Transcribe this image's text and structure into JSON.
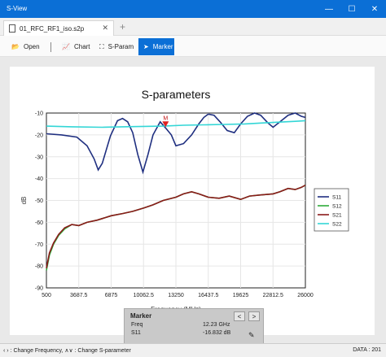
{
  "window": {
    "title": "S-View",
    "minimize": "—",
    "maximize": "☐",
    "close": "✕"
  },
  "tabs": [
    {
      "label": "01_RFC_RF1_iso.s2p",
      "close": "✕"
    }
  ],
  "new_tab": "+",
  "toolbar": {
    "open": {
      "icon": "📂",
      "label": "Open"
    },
    "chart": {
      "icon": "📈",
      "label": "Chart"
    },
    "sparam": {
      "icon": "⛶",
      "label": "S-Param"
    },
    "marker": {
      "icon": "➤",
      "label": "Marker"
    }
  },
  "marker_panel": {
    "title": "Marker",
    "prev": "<",
    "next": ">",
    "freq_label": "Freq",
    "freq_value": "12.23 GHz",
    "param_label": "S11",
    "param_value": "-16.832 dB",
    "edit_icon": "✎"
  },
  "status": {
    "hint": "‹ › : Change Frequency,  ∧∨ : Change S-parameter",
    "data": "DATA : 201"
  },
  "colors": {
    "accent": "#0b6fd6",
    "s11": "#1f2f80",
    "s12": "#2eab3a",
    "s21": "#8b1a1a",
    "s22": "#33d6d6"
  },
  "chart_data": {
    "type": "line",
    "title": "S-parameters",
    "xlabel": "Frequency (MHz)",
    "ylabel": "dB",
    "xlim": [
      500,
      26000
    ],
    "ylim": [
      -90,
      -10
    ],
    "xticks": [
      "500",
      "3687.5",
      "6875",
      "10062.5",
      "13250",
      "16437.5",
      "19625",
      "22812.5",
      "26000"
    ],
    "yticks": [
      "-10",
      "-20",
      "-30",
      "-40",
      "-50",
      "-60",
      "-70",
      "-80",
      "-90"
    ],
    "legend_position": "right",
    "marker": {
      "label": "M",
      "x": 12230,
      "y": -16.8
    },
    "series": [
      {
        "name": "S11",
        "color": "#1f2f80",
        "x": [
          500,
          2000,
          3500,
          4500,
          5200,
          5600,
          6000,
          6800,
          7500,
          8000,
          8500,
          9000,
          9500,
          10000,
          10500,
          11000,
          11700,
          12230,
          12800,
          13250,
          14000,
          14800,
          15500,
          16000,
          16437,
          17000,
          17600,
          18300,
          19000,
          19625,
          20300,
          21000,
          21600,
          22300,
          22813,
          23500,
          24300,
          25000,
          25600,
          26000
        ],
        "y": [
          -19.5,
          -20,
          -21,
          -25,
          -31,
          -36,
          -33,
          -20.5,
          -13.5,
          -12.5,
          -14,
          -19,
          -29,
          -37,
          -29,
          -20,
          -14,
          -16.8,
          -20,
          -25,
          -24,
          -20,
          -15,
          -12,
          -10.5,
          -11,
          -14,
          -18,
          -19,
          -15,
          -11.5,
          -10,
          -11,
          -14.5,
          -16.5,
          -14,
          -11,
          -10,
          -11.5,
          -12
        ]
      },
      {
        "name": "S12",
        "color": "#2eab3a",
        "x": [
          500,
          800,
          1200,
          1700,
          2300,
          3000,
          3687,
          4500,
          5500,
          6875,
          8000,
          9000,
          10062,
          11000,
          12000,
          13250,
          14000,
          14800,
          15500,
          16437,
          17500,
          18500,
          19625,
          20500,
          21500,
          22813,
          23500,
          24300,
          25000,
          25600,
          26000
        ],
        "y": [
          -82,
          -75,
          -70,
          -66,
          -63,
          -61,
          -61.5,
          -60,
          -59,
          -57,
          -56,
          -55,
          -53.5,
          -52,
          -50,
          -48.5,
          -47,
          -46,
          -47,
          -48.5,
          -49,
          -48,
          -49.5,
          -48,
          -47.5,
          -47,
          -46,
          -44.5,
          -45,
          -44,
          -43
        ]
      },
      {
        "name": "S21",
        "color": "#8b1a1a",
        "x": [
          500,
          800,
          1200,
          1700,
          2300,
          3000,
          3687,
          4500,
          5500,
          6875,
          8000,
          9000,
          10062,
          11000,
          12000,
          13250,
          14000,
          14800,
          15500,
          16437,
          17500,
          18500,
          19625,
          20500,
          21500,
          22813,
          23500,
          24300,
          25000,
          25600,
          26000
        ],
        "y": [
          -81,
          -74,
          -69.5,
          -65.5,
          -62.5,
          -61,
          -61.5,
          -60,
          -59,
          -57,
          -56,
          -55,
          -53.5,
          -52,
          -50,
          -48.5,
          -47,
          -46,
          -47,
          -48.5,
          -49,
          -48,
          -49.5,
          -48,
          -47.5,
          -47,
          -46,
          -44.5,
          -45,
          -44,
          -43
        ]
      },
      {
        "name": "S22",
        "color": "#33d6d6",
        "x": [
          500,
          3000,
          6000,
          9000,
          12000,
          14000,
          16000,
          18000,
          20000,
          22000,
          24000,
          25000,
          26000
        ],
        "y": [
          -16,
          -16.3,
          -16.5,
          -16.2,
          -16,
          -15.6,
          -15.4,
          -15.2,
          -15,
          -14.5,
          -14,
          -13.8,
          -13.5
        ]
      }
    ]
  }
}
